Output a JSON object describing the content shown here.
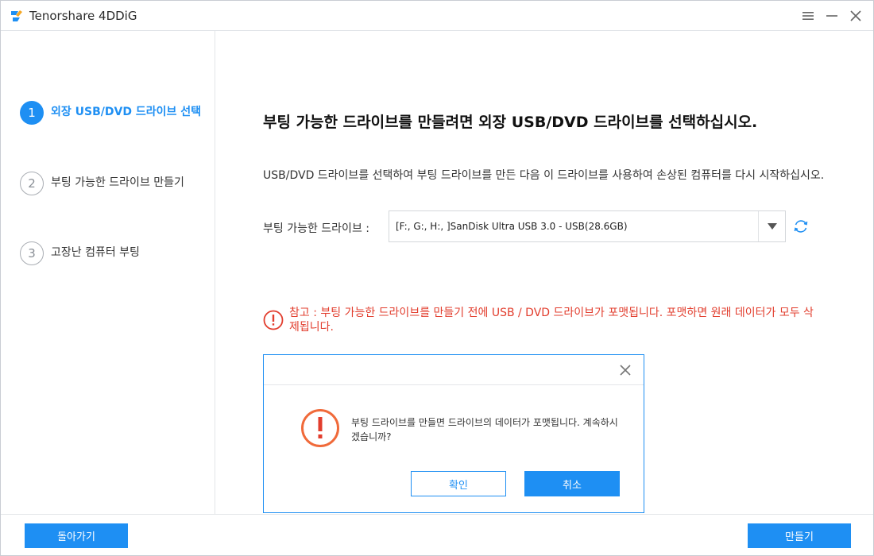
{
  "app": {
    "title": "Tenorshare 4DDiG",
    "logo": "tenorshare-logo"
  },
  "window_controls": {
    "menu": "menu-icon",
    "minimize": "minimize-icon",
    "close": "close-icon"
  },
  "sidebar": {
    "steps": [
      {
        "number": "1",
        "label": "외장 USB/DVD 드라이브 선택",
        "state": "active"
      },
      {
        "number": "2",
        "label": "부팅 가능한 드라이브 만들기",
        "state": "inactive"
      },
      {
        "number": "3",
        "label": "고장난 컴퓨터 부팅",
        "state": "inactive"
      }
    ]
  },
  "main": {
    "title": "부팅 가능한 드라이브를 만들려면 외장 USB/DVD 드라이브를 선택하십시오.",
    "description": "USB/DVD 드라이브를 선택하여 부팅 드라이브를 만든 다음 이 드라이브를 사용하여 손상된 컴퓨터를 다시 시작하십시오.",
    "drive_label": "부팅 가능한 드라이브 :",
    "drive_value": "[F:, G:, H:, ]SanDisk Ultra USB 3.0 - USB(28.6GB)",
    "warning": "참고 : 부팅 가능한 드라이브를 만들기 전에 USB / DVD 드라이브가 포맷됩니다. 포맷하면 원래 데이터가 모두 삭제됩니다."
  },
  "dialog": {
    "message": "부팅 드라이브를 만들면 드라이브의 데이터가 포맷됩니다. 계속하시겠습니까?",
    "confirm_label": "확인",
    "cancel_label": "취소"
  },
  "footer": {
    "back_label": "돌아가기",
    "make_label": "만들기"
  },
  "colors": {
    "accent": "#1e8ff3",
    "warning": "#e23d2d",
    "dialog_icon": "#f06a3a"
  }
}
